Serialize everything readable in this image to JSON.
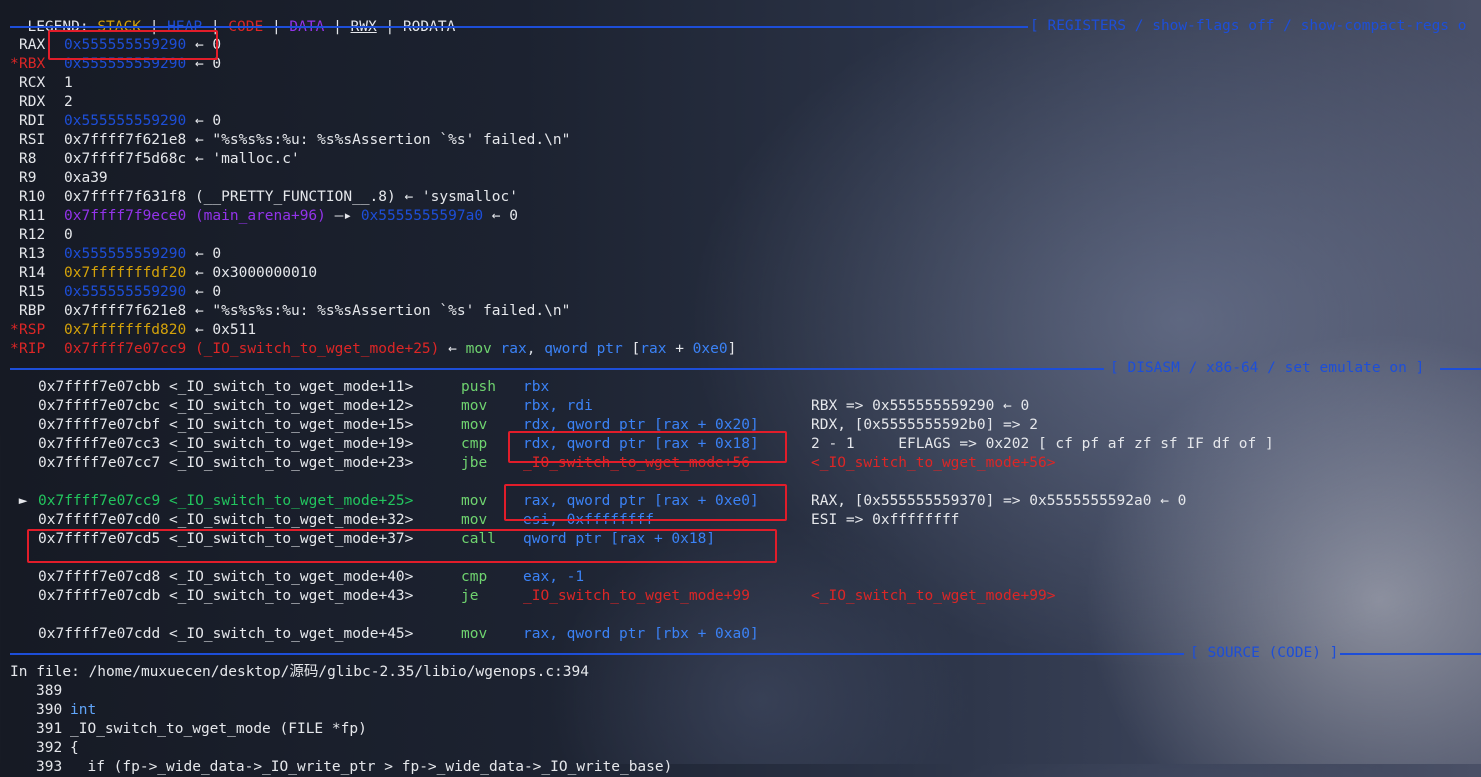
{
  "legend": {
    "label": "LEGEND:",
    "items": [
      "STACK",
      "HEAP",
      "CODE",
      "DATA",
      "RWX",
      "RODATA"
    ],
    "sep": "|"
  },
  "headers": {
    "registers": "[ REGISTERS / show-flags off / show-compact-regs o",
    "disasm": "[ DISASM / x86-64 / set emulate on ]",
    "source": "[ SOURCE (CODE) ]"
  },
  "registers": [
    {
      "name": "RAX",
      "mark": "",
      "v1": "0x555555559290",
      "v1c": "heap",
      "rest": " ← 0"
    },
    {
      "name": "RBX",
      "mark": "*",
      "v1": "0x555555559290",
      "v1c": "heap",
      "rest": " ← 0"
    },
    {
      "name": "RCX",
      "mark": "",
      "v1": "1",
      "v1c": "white",
      "rest": ""
    },
    {
      "name": "RDX",
      "mark": "",
      "v1": "2",
      "v1c": "white",
      "rest": ""
    },
    {
      "name": "RDI",
      "mark": "",
      "v1": "0x555555559290",
      "v1c": "heap",
      "rest": " ← 0"
    },
    {
      "name": "RSI",
      "mark": "",
      "v1": "0x7ffff7f621e8",
      "v1c": "white",
      "rest": " ← \"%s%s%s:%u: %s%sAssertion `%s' failed.\\n\""
    },
    {
      "name": "R8",
      "mark": "",
      "v1": "0x7ffff7f5d68c",
      "v1c": "white",
      "rest": " ← 'malloc.c'"
    },
    {
      "name": "R9",
      "mark": "",
      "v1": "0xa39",
      "v1c": "white",
      "rest": ""
    },
    {
      "name": "R10",
      "mark": "",
      "v1": "0x7ffff7f631f8",
      "v1c": "white",
      "rest": " (__PRETTY_FUNCTION__.8) ← 'sysmalloc'"
    },
    {
      "name": "R11",
      "mark": "",
      "v1": "0x7ffff7f9ece0 (main_arena+96)",
      "v1c": "data",
      "rest": " —▸ ",
      "v2": "0x5555555597a0",
      "v2c": "heap",
      "rest2": " ← 0"
    },
    {
      "name": "R12",
      "mark": "",
      "v1": "0",
      "v1c": "white",
      "rest": ""
    },
    {
      "name": "R13",
      "mark": "",
      "v1": "0x555555559290",
      "v1c": "heap",
      "rest": " ← 0"
    },
    {
      "name": "R14",
      "mark": "",
      "v1": "0x7fffffffdf20",
      "v1c": "stack",
      "rest": " ← 0x3000000010"
    },
    {
      "name": "R15",
      "mark": "",
      "v1": "0x555555559290",
      "v1c": "heap",
      "rest": " ← 0"
    },
    {
      "name": "RBP",
      "mark": "",
      "v1": "0x7ffff7f621e8",
      "v1c": "white",
      "rest": " ← \"%s%s%s:%u: %s%sAssertion `%s' failed.\\n\""
    },
    {
      "name": "RSP",
      "mark": "*",
      "v1": "0x7fffffffd820",
      "v1c": "stack",
      "rest": " ← 0x511"
    },
    {
      "name": "RIP",
      "mark": "*",
      "v1": "0x7ffff7e07cc9 (_IO_switch_to_wget_mode+25)",
      "v1c": "code",
      "rest": " ← ",
      "v2": "mov rax, qword ptr [rax + 0xe0]",
      "v2c": "asm"
    }
  ],
  "disasm": [
    {
      "addr": "0x7ffff7e07cbb <_IO_switch_to_wget_mode+11>",
      "op": "push",
      "args": "rbx",
      "note": ""
    },
    {
      "addr": "0x7ffff7e07cbc <_IO_switch_to_wget_mode+12>",
      "op": "mov",
      "args": "rbx, rdi",
      "note": "RBX => 0x555555559290 ← 0"
    },
    {
      "addr": "0x7ffff7e07cbf <_IO_switch_to_wget_mode+15>",
      "op": "mov",
      "args": "rdx, qword ptr [rax + 0x20]",
      "note": "RDX, [0x5555555592b0] => 2"
    },
    {
      "addr": "0x7ffff7e07cc3 <_IO_switch_to_wget_mode+19>",
      "op": "cmp",
      "args": "rdx, qword ptr [rax + 0x18]",
      "note": "2 - 1     EFLAGS => 0x202 [ cf pf af zf sf IF df of ]"
    },
    {
      "addr": "0x7ffff7e07cc7 <_IO_switch_to_wget_mode+23>",
      "op": "jbe",
      "args": "_IO_switch_to_wget_mode+56",
      "note": "<_IO_switch_to_wget_mode+56>"
    },
    {
      "addr": "",
      "op": "",
      "args": "",
      "note": ""
    },
    {
      "addr": "0x7ffff7e07cc9 <_IO_switch_to_wget_mode+25>",
      "op": "mov",
      "args": "rax, qword ptr [rax + 0xe0]",
      "note": "RAX, [0x555555559370] => 0x5555555592a0 ← 0",
      "current": true
    },
    {
      "addr": "0x7ffff7e07cd0 <_IO_switch_to_wget_mode+32>",
      "op": "mov",
      "args": "esi, 0xffffffff",
      "note": "ESI => 0xffffffff"
    },
    {
      "addr": "0x7ffff7e07cd5 <_IO_switch_to_wget_mode+37>",
      "op": "call",
      "args": "qword ptr [rax + 0x18]",
      "note": ""
    },
    {
      "addr": "",
      "op": "",
      "args": "",
      "note": ""
    },
    {
      "addr": "0x7ffff7e07cd8 <_IO_switch_to_wget_mode+40>",
      "op": "cmp",
      "args": "eax, -1",
      "note": ""
    },
    {
      "addr": "0x7ffff7e07cdb <_IO_switch_to_wget_mode+43>",
      "op": "je",
      "args": "_IO_switch_to_wget_mode+99",
      "note": "<_IO_switch_to_wget_mode+99>"
    },
    {
      "addr": "",
      "op": "",
      "args": "",
      "note": ""
    },
    {
      "addr": "0x7ffff7e07cdd <_IO_switch_to_wget_mode+45>",
      "op": "mov",
      "args": "rax, qword ptr [rbx + 0xa0]",
      "note": ""
    }
  ],
  "source": {
    "file_line": "In file: /home/muxuecen/desktop/源码/glibc-2.35/libio/wgenops.c:394",
    "lines": [
      {
        "no": "389",
        "code": ""
      },
      {
        "no": "390",
        "code": "int"
      },
      {
        "no": "391",
        "code": "_IO_switch_to_wget_mode (FILE *fp)"
      },
      {
        "no": "392",
        "code": "{"
      },
      {
        "no": "393",
        "code": "  if (fp->_wide_data->_IO_write_ptr > fp->_wide_data->_IO_write_base)"
      }
    ]
  }
}
